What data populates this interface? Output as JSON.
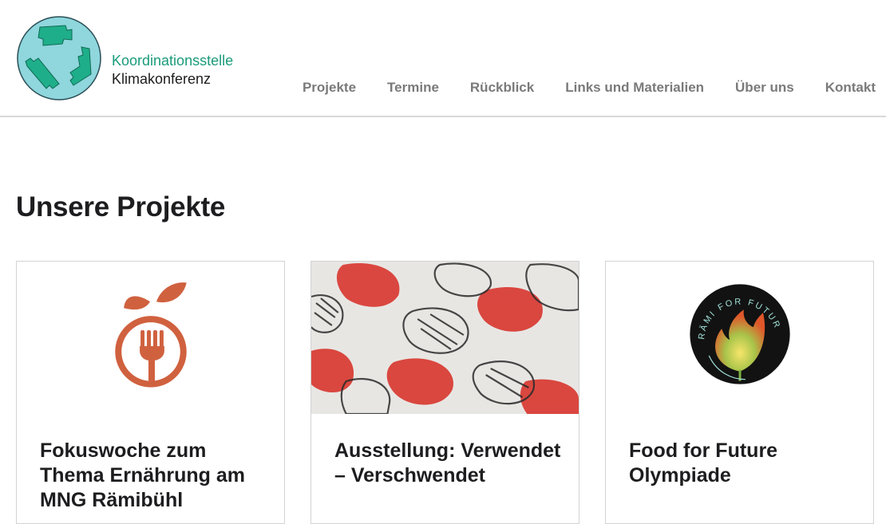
{
  "brand": {
    "line1": "Koordinationsstelle",
    "line2": "Klimakonferenz",
    "logo_icon": "puzzle-circle-logo-icon",
    "accent": "#1a9b7a",
    "logo_bg": "#8fd6dd"
  },
  "nav": {
    "items": [
      "Projekte",
      "Termine",
      "Rückblick",
      "Links und Materialien",
      "Über uns",
      "Kontakt"
    ]
  },
  "main": {
    "heading": "Unsere Projekte",
    "cards": [
      {
        "title": "Fokuswoche zum Thema Ernährung am MNG Rämibühl",
        "icon": "apple-fork-icon",
        "color": "#d0613f"
      },
      {
        "title": "Ausstellung: Verwendet – Verschwendet",
        "icon": "lino-print-cabbage-image"
      },
      {
        "title": "Food for Future Olympiade",
        "icon": "rami-for-future-logo",
        "logo_text": "RÄMI FOR FUTURE"
      }
    ]
  }
}
